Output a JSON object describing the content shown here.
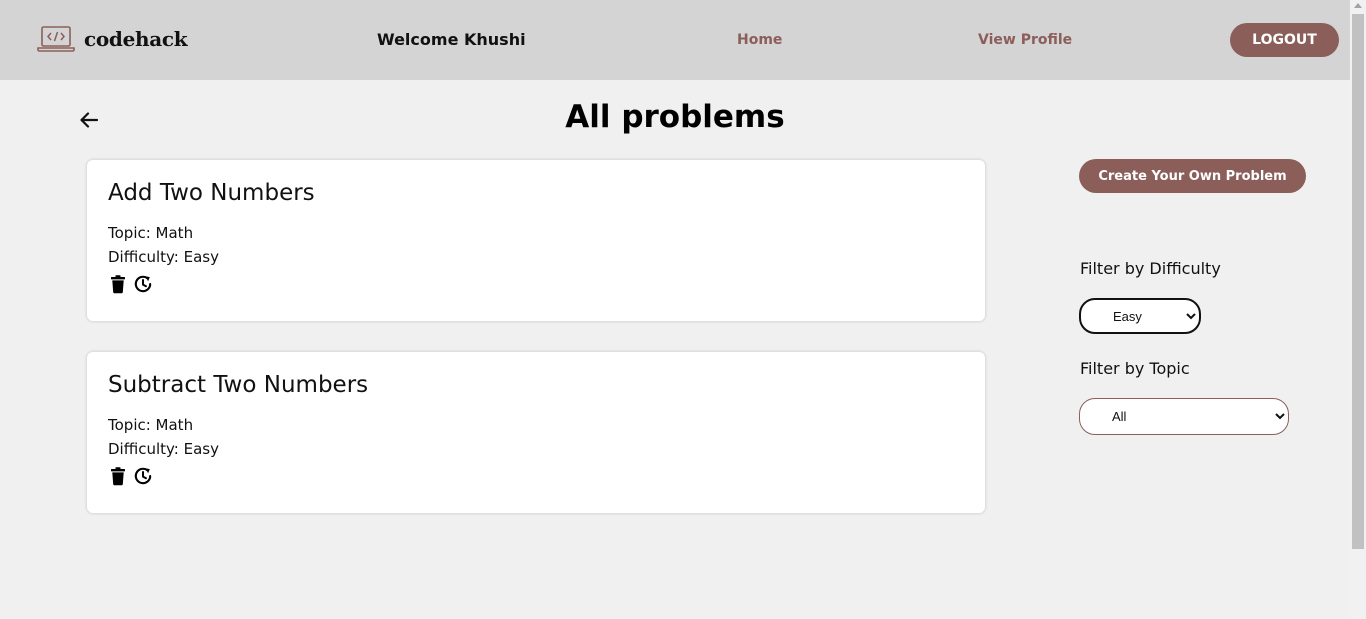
{
  "header": {
    "logo_text": "codehack",
    "logo_icon": "laptop-code-icon",
    "welcome": "Welcome Khushi",
    "nav_home": "Home",
    "nav_profile": "View Profile",
    "logout": "LOGOUT"
  },
  "page": {
    "title": "All problems",
    "back_icon": "arrow-left-icon"
  },
  "problems": [
    {
      "title": "Add Two Numbers",
      "topic": "Topic: Math",
      "difficulty": "Difficulty: Easy"
    },
    {
      "title": "Subtract Two Numbers",
      "topic": "Topic: Math",
      "difficulty": "Difficulty: Easy"
    }
  ],
  "sidebar": {
    "create_button": "Create Your Own Problem",
    "filter_difficulty_label": "Filter by Difficulty",
    "filter_difficulty_value": "Easy",
    "filter_topic_label": "Filter by Topic",
    "filter_topic_value": "All"
  },
  "colors": {
    "accent": "#8b5e5a",
    "header_bg": "#d4d4d4",
    "page_bg": "#f0f0f0"
  }
}
